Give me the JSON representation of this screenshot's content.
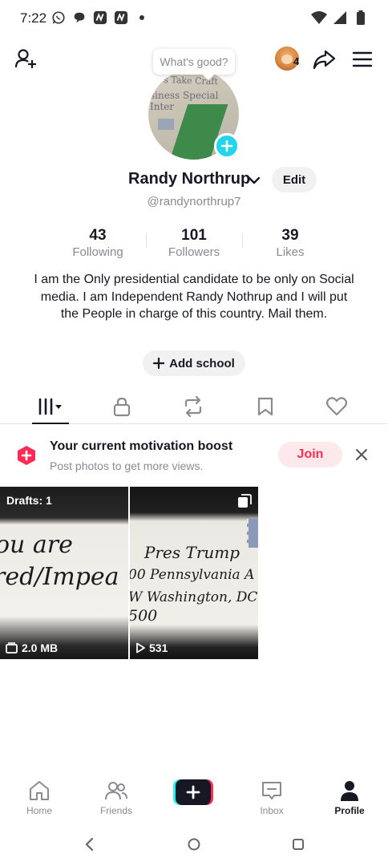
{
  "status_bar": {
    "time": "7:22"
  },
  "top_bar": {
    "avatar_count": "4"
  },
  "profile": {
    "tooltip": "What's good?",
    "display_name": "Randy Northrup",
    "edit_label": "Edit",
    "username": "@randynorthrup7",
    "stats": [
      {
        "value": "43",
        "label": "Following"
      },
      {
        "value": "101",
        "label": "Followers"
      },
      {
        "value": "39",
        "label": "Likes"
      }
    ],
    "bio": "I am the Only presidential candidate to be only on Social media. I am Independent Randy Nothrup and I will put the People in charge of this country. Mail them.",
    "add_school_label": "Add school",
    "avatar_image_text": {
      "line1": "y's Take Craft",
      "line2": "siness  Special Inter"
    }
  },
  "promo": {
    "title": "Your current motivation boost",
    "subtitle": "Post photos to get more views.",
    "join_label": "Join"
  },
  "grid": {
    "tiles": [
      {
        "badge": "Drafts: 1",
        "footer": "2.0 MB",
        "handwriting": [
          "ou are",
          "red/Impea"
        ]
      },
      {
        "footer": "531",
        "handwriting": [
          "Pres Trump",
          "00 Pennsylvania A",
          "W Washington, DC",
          "500"
        ]
      }
    ]
  },
  "bottom_nav": {
    "items": [
      {
        "label": "Home"
      },
      {
        "label": "Friends"
      },
      {
        "label": "Inbox"
      },
      {
        "label": "Profile"
      }
    ]
  },
  "colors": {
    "accent_red": "#fe2c55",
    "accent_cyan": "#25f4ee",
    "plus_badge": "#20d5ec",
    "text_primary": "#161823",
    "text_secondary": "#8a8b91"
  }
}
